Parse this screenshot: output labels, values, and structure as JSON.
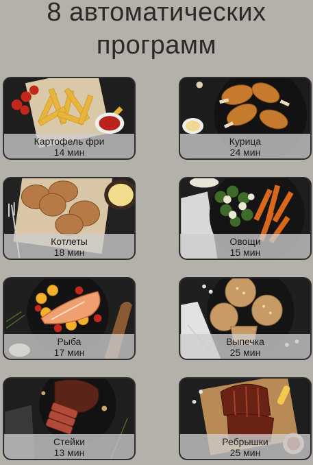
{
  "title_line1": "8 автоматических",
  "title_line2": "программ",
  "programs": [
    {
      "name": "Картофель фри",
      "time": "14 мин",
      "icon": "fries-photo"
    },
    {
      "name": "Курица",
      "time": "24 мин",
      "icon": "chicken-photo"
    },
    {
      "name": "Котлеты",
      "time": "18 мин",
      "icon": "cutlets-photo"
    },
    {
      "name": "Овощи",
      "time": "15 мин",
      "icon": "vegetables-photo"
    },
    {
      "name": "Рыба",
      "time": "17 мин",
      "icon": "fish-photo"
    },
    {
      "name": "Выпечка",
      "time": "25 мин",
      "icon": "pastry-photo"
    },
    {
      "name": "Стейки",
      "time": "13 мин",
      "icon": "steak-photo"
    },
    {
      "name": "Ребрышки",
      "time": "25 мин",
      "icon": "ribs-photo"
    }
  ],
  "colors": {
    "background": "#b4b0aa",
    "title": "#2c2a28",
    "card_border": "#2e2e2e"
  }
}
